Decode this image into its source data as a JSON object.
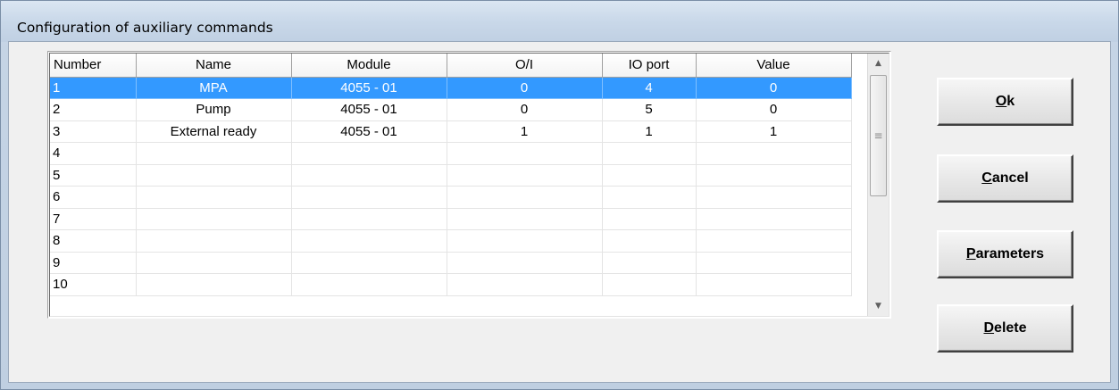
{
  "window": {
    "title": "Configuration of auxiliary commands"
  },
  "table": {
    "columns": [
      "Number",
      "Name",
      "Module",
      "O/I",
      "IO port",
      "Value"
    ],
    "rows": [
      {
        "number": "1",
        "name": "MPA",
        "module": "4055 - 01",
        "oi": "0",
        "io_port": "4",
        "value": "0",
        "selected": true
      },
      {
        "number": "2",
        "name": "Pump",
        "module": "4055 - 01",
        "oi": "0",
        "io_port": "5",
        "value": "0"
      },
      {
        "number": "3",
        "name": "External ready",
        "module": "4055 - 01",
        "oi": "1",
        "io_port": "1",
        "value": "1"
      },
      {
        "number": "4",
        "name": "",
        "module": "",
        "oi": "",
        "io_port": "",
        "value": ""
      },
      {
        "number": "5",
        "name": "",
        "module": "",
        "oi": "",
        "io_port": "",
        "value": ""
      },
      {
        "number": "6",
        "name": "",
        "module": "",
        "oi": "",
        "io_port": "",
        "value": ""
      },
      {
        "number": "7",
        "name": "",
        "module": "",
        "oi": "",
        "io_port": "",
        "value": ""
      },
      {
        "number": "8",
        "name": "",
        "module": "",
        "oi": "",
        "io_port": "",
        "value": ""
      },
      {
        "number": "9",
        "name": "",
        "module": "",
        "oi": "",
        "io_port": "",
        "value": ""
      },
      {
        "number": "10",
        "name": "",
        "module": "",
        "oi": "",
        "io_port": "",
        "value": ""
      }
    ]
  },
  "buttons": {
    "ok": {
      "mnemonic": "O",
      "rest": "k"
    },
    "cancel": {
      "mnemonic": "C",
      "rest": "ancel"
    },
    "parameters": {
      "mnemonic": "P",
      "rest": "arameters"
    },
    "delete": {
      "mnemonic": "D",
      "rest": "elete"
    }
  },
  "colors": {
    "selection": "#3399ff",
    "window_frame": "#c5d4e5",
    "client_bg": "#f0f0f0"
  },
  "icons": {
    "scroll_up": "triangle-up-icon",
    "scroll_down": "triangle-down-icon",
    "thumb_grip": "grip-icon"
  }
}
